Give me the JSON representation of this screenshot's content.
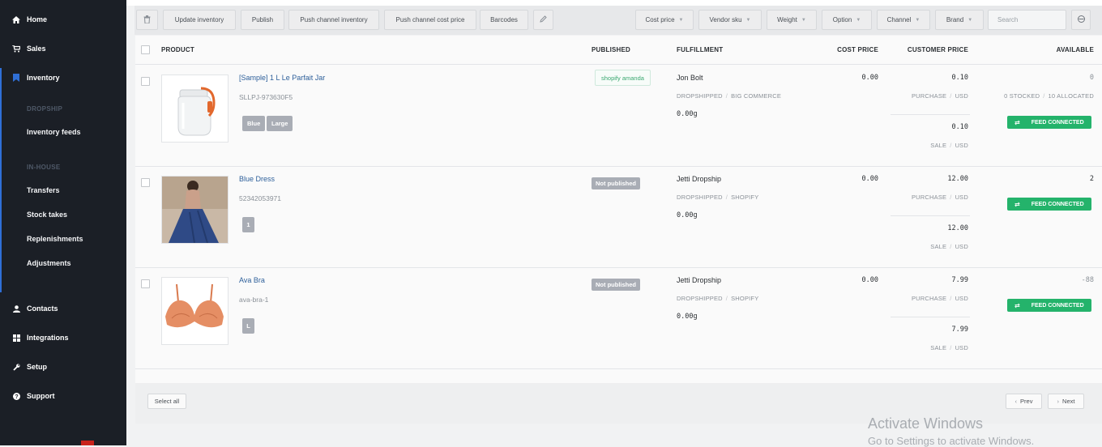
{
  "sidebar": {
    "items": [
      {
        "label": "Home",
        "icon": "home-icon"
      },
      {
        "label": "Sales",
        "icon": "cart-icon"
      },
      {
        "label": "Inventory",
        "icon": "bookmark-icon"
      }
    ],
    "sections": {
      "dropship": "DROPSHIP",
      "inhouse": "IN-HOUSE"
    },
    "dropship_items": [
      "Inventory feeds"
    ],
    "inhouse_items": [
      "Transfers",
      "Stock takes",
      "Replenishments",
      "Adjustments"
    ],
    "bottom_items": [
      {
        "label": "Contacts",
        "icon": "user-icon"
      },
      {
        "label": "Integrations",
        "icon": "grid-icon"
      },
      {
        "label": "Setup",
        "icon": "wrench-icon"
      },
      {
        "label": "Support",
        "icon": "help-icon"
      }
    ]
  },
  "toolbar": {
    "buttons": [
      "Update inventory",
      "Publish",
      "Push channel inventory",
      "Push channel cost price",
      "Barcodes"
    ],
    "filters": [
      "Cost price",
      "Vendor sku",
      "Weight",
      "Option",
      "Channel",
      "Brand"
    ],
    "search_placeholder": "Search"
  },
  "table": {
    "headers": {
      "product": "PRODUCT",
      "published": "PUBLISHED",
      "fulfillment": "FULFILLMENT",
      "cost_price": "COST PRICE",
      "customer_price": "CUSTOMER PRICE",
      "available": "AVAILABLE"
    },
    "rows": [
      {
        "name": "[Sample] 1 L Le Parfait Jar",
        "sku": "SLLPJ-973630F5",
        "options": [
          "Blue",
          "Large"
        ],
        "published": "shopify amanda",
        "published_state": "published",
        "fulfiller": "Jon Bolt",
        "fulfillment_type": "DROPSHIPPED",
        "fulfillment_channel": "BIG COMMERCE",
        "weight": "0.00g",
        "cost_price": "0.00",
        "purchase_price": "0.10",
        "purchase_label": "PURCHASE",
        "sale_price": "0.10",
        "sale_label": "SALE",
        "currency": "USD",
        "available": "0",
        "stocked": "0 STOCKED",
        "allocated": "10 ALLOCATED",
        "feed_status": "FEED CONNECTED"
      },
      {
        "name": "Blue Dress",
        "sku": "52342053971",
        "options": [
          "1"
        ],
        "published": "Not published",
        "published_state": "unpublished",
        "fulfiller": "Jetti Dropship",
        "fulfillment_type": "DROPSHIPPED",
        "fulfillment_channel": "SHOPIFY",
        "weight": "0.00g",
        "cost_price": "0.00",
        "purchase_price": "12.00",
        "purchase_label": "PURCHASE",
        "sale_price": "12.00",
        "sale_label": "SALE",
        "currency": "USD",
        "available": "2",
        "feed_status": "FEED CONNECTED"
      },
      {
        "name": "Ava Bra",
        "sku": "ava-bra-1",
        "options": [
          "L"
        ],
        "published": "Not published",
        "published_state": "unpublished",
        "fulfiller": "Jetti Dropship",
        "fulfillment_type": "DROPSHIPPED",
        "fulfillment_channel": "SHOPIFY",
        "weight": "0.00g",
        "cost_price": "0.00",
        "purchase_price": "7.99",
        "purchase_label": "PURCHASE",
        "sale_price": "7.99",
        "sale_label": "SALE",
        "currency": "USD",
        "available": "-88",
        "feed_status": "FEED CONNECTED"
      }
    ]
  },
  "footer": {
    "select_all": "Select all",
    "prev": "Prev",
    "next": "Next"
  },
  "watermark": {
    "line1": "Activate Windows",
    "line2": "Go to Settings to activate Windows."
  },
  "colors": {
    "sidebar_bg": "#1b1f26",
    "accent": "#2f6fd6",
    "feed_green": "#24b36b",
    "link": "#2d5f9a",
    "chip_gray": "#a9adb5"
  }
}
